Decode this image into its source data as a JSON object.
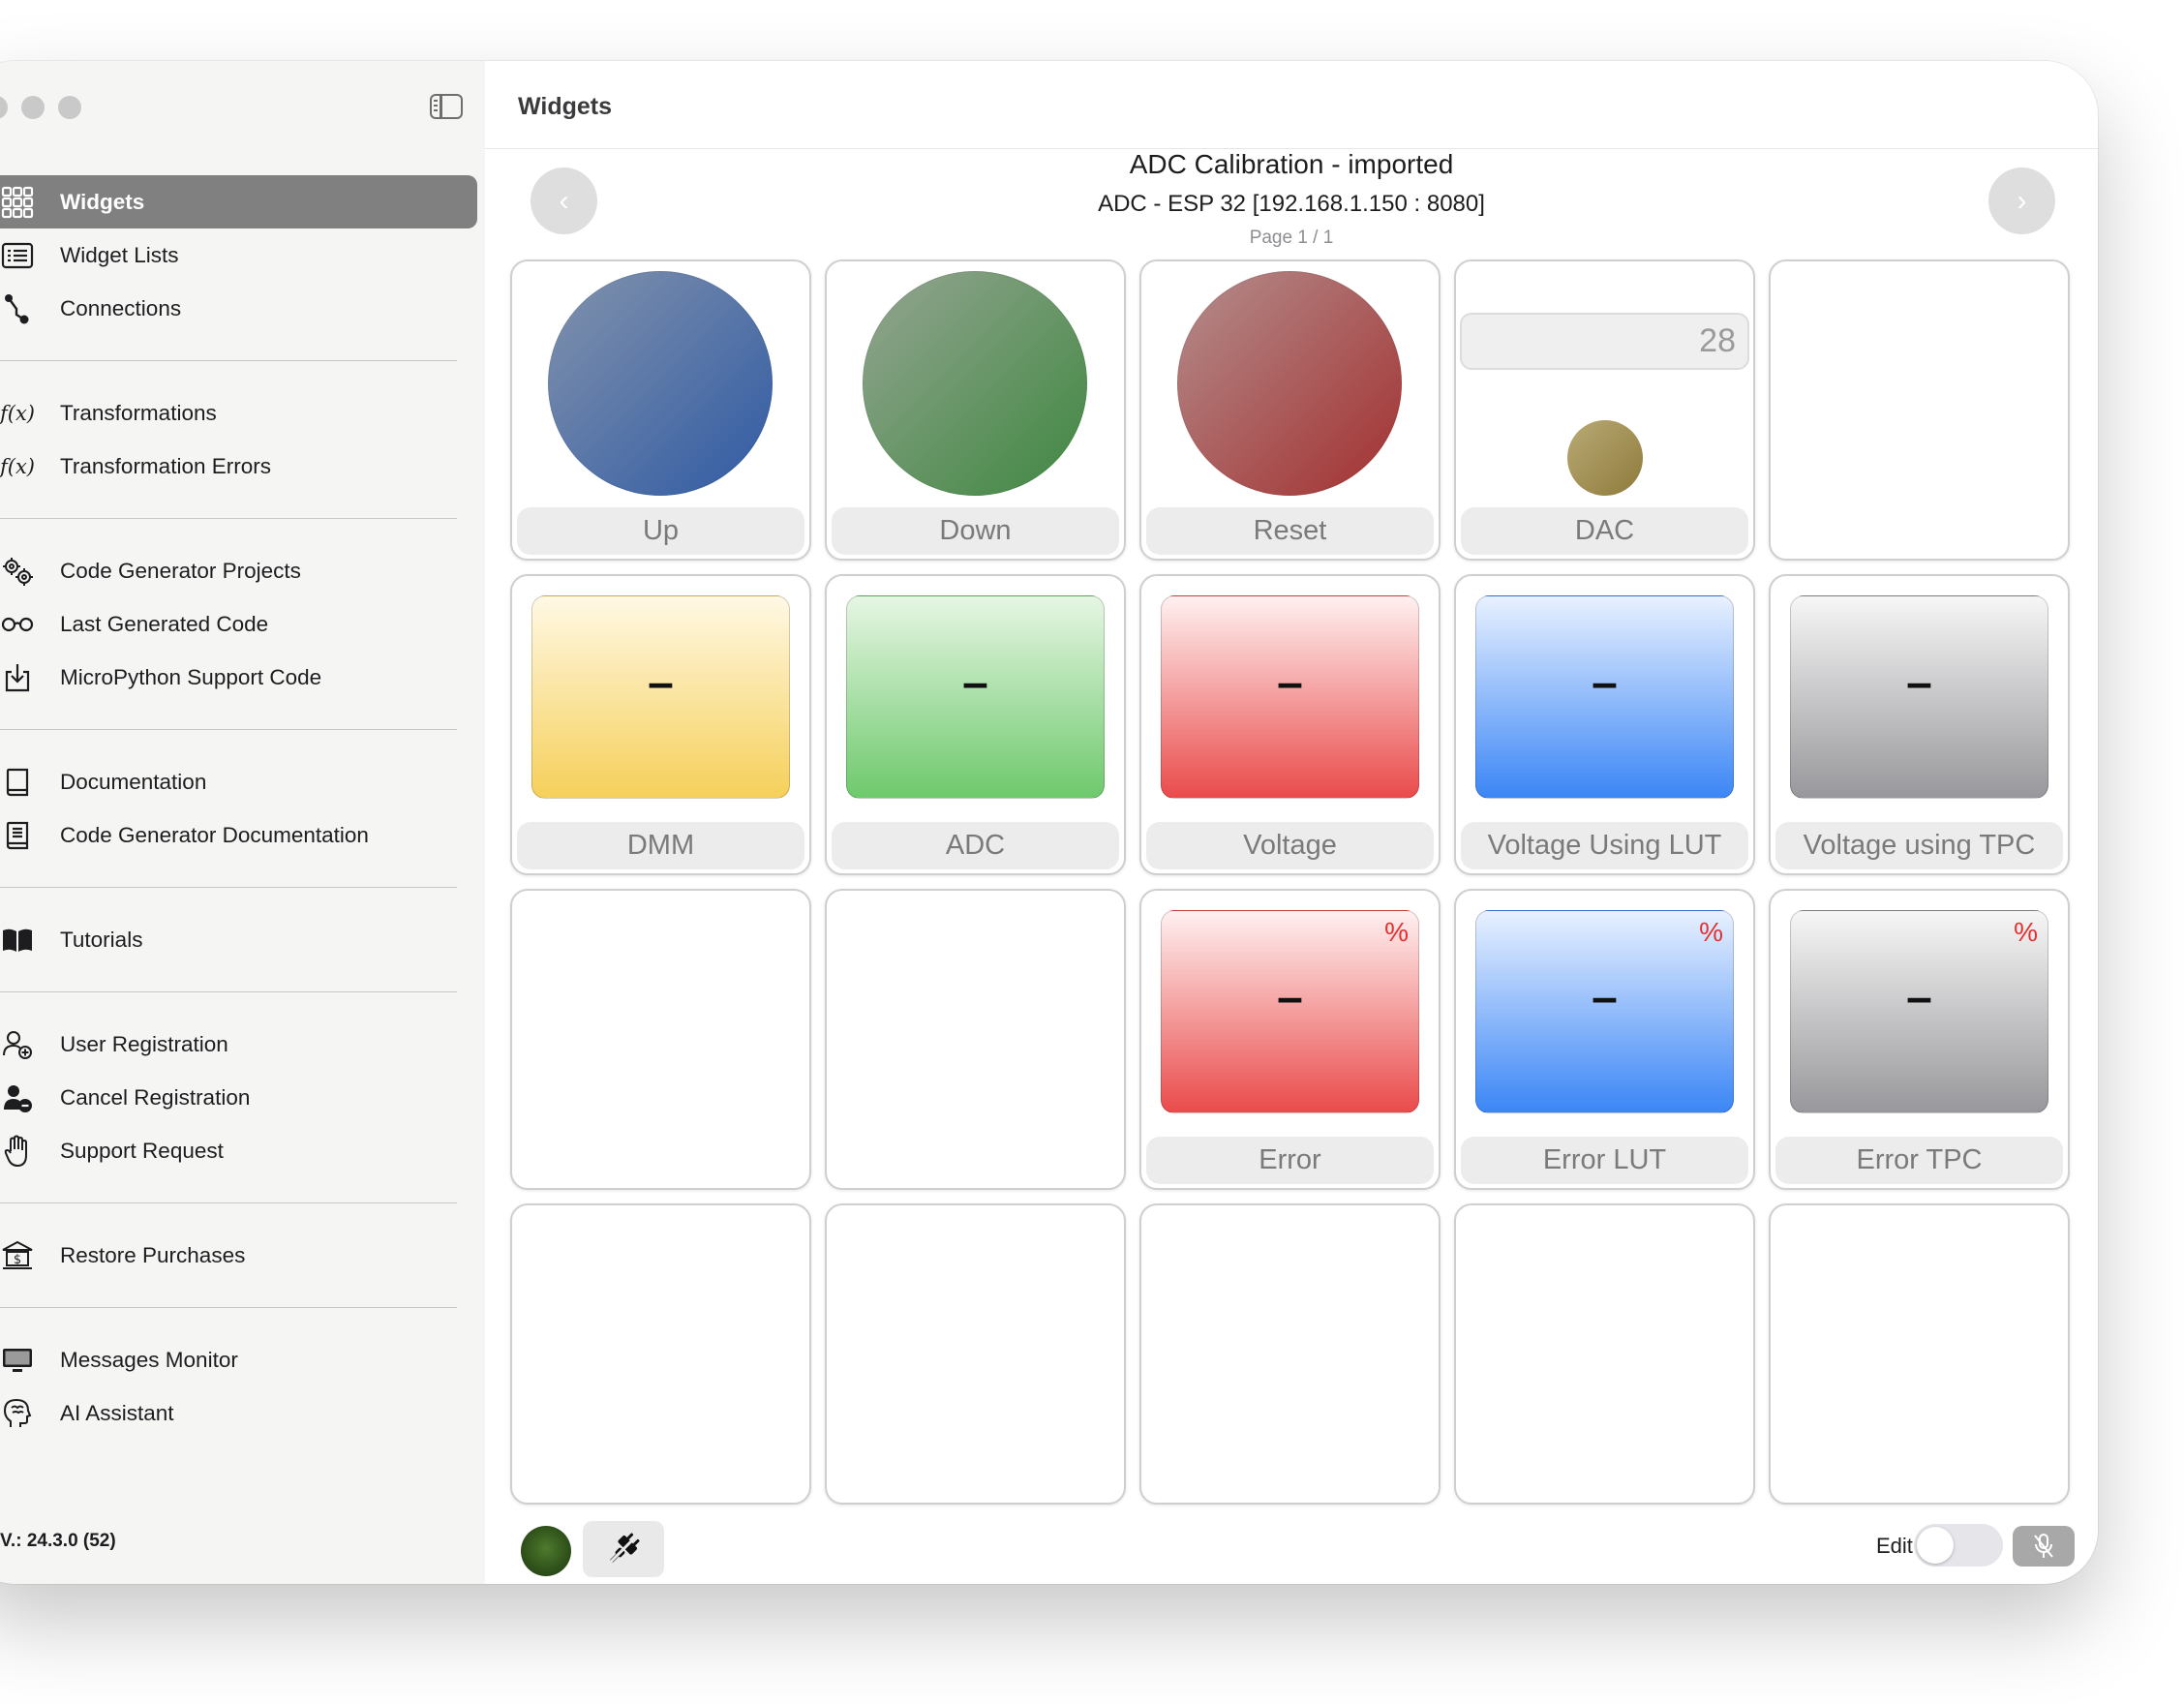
{
  "sidebar": {
    "groups": [
      {
        "items": [
          {
            "label": "Widgets",
            "icon": "grid-icon",
            "active": true
          },
          {
            "label": "Widget Lists",
            "icon": "list-icon"
          },
          {
            "label": "Connections",
            "icon": "connections-icon"
          }
        ]
      },
      {
        "items": [
          {
            "label": "Transformations",
            "icon": "function-icon"
          },
          {
            "label": "Transformation Errors",
            "icon": "function-icon"
          }
        ]
      },
      {
        "items": [
          {
            "label": "Code Generator Projects",
            "icon": "gears-icon"
          },
          {
            "label": "Last Generated Code",
            "icon": "glasses-icon"
          },
          {
            "label": "MicroPython Support Code",
            "icon": "download-icon"
          }
        ]
      },
      {
        "items": [
          {
            "label": "Documentation",
            "icon": "book-icon"
          },
          {
            "label": "Code Generator Documentation",
            "icon": "document-icon"
          }
        ]
      },
      {
        "items": [
          {
            "label": "Tutorials",
            "icon": "open-book-icon"
          }
        ]
      },
      {
        "items": [
          {
            "label": "User Registration",
            "icon": "person-add-icon"
          },
          {
            "label": "Cancel Registration",
            "icon": "person-remove-icon"
          },
          {
            "label": "Support Request",
            "icon": "hand-icon"
          }
        ]
      },
      {
        "items": [
          {
            "label": "Restore Purchases",
            "icon": "bank-icon"
          }
        ]
      },
      {
        "items": [
          {
            "label": "Messages Monitor",
            "icon": "monitor-icon"
          },
          {
            "label": "AI Assistant",
            "icon": "brain-head-icon"
          }
        ]
      }
    ],
    "version": "V.: 24.3.0 (52)"
  },
  "toolbar": {
    "title": "Widgets"
  },
  "header": {
    "title": "ADC Calibration - imported",
    "subtitle": "ADC - ESP 32 [192.168.1.150 : 8080]",
    "page": "Page 1 / 1",
    "prev_icon": "chevron-left-icon",
    "next_icon": "chevron-right-icon"
  },
  "widgets": [
    {
      "type": "button",
      "label": "Up",
      "color": "blue"
    },
    {
      "type": "button",
      "label": "Down",
      "color": "green"
    },
    {
      "type": "button",
      "label": "Reset",
      "color": "red"
    },
    {
      "type": "slider",
      "label": "DAC",
      "value": "28"
    },
    {
      "type": "empty"
    },
    {
      "type": "display",
      "label": "DMM",
      "value": "–",
      "color": "yellow"
    },
    {
      "type": "display",
      "label": "ADC",
      "value": "–",
      "color": "green"
    },
    {
      "type": "display",
      "label": "Voltage",
      "value": "–",
      "color": "red"
    },
    {
      "type": "display",
      "label": "Voltage Using LUT",
      "value": "–",
      "color": "blue"
    },
    {
      "type": "display",
      "label": "Voltage using TPC",
      "value": "–",
      "color": "gray"
    },
    {
      "type": "empty"
    },
    {
      "type": "empty"
    },
    {
      "type": "display",
      "label": "Error",
      "value": "–",
      "unit": "%",
      "color": "red"
    },
    {
      "type": "display",
      "label": "Error LUT",
      "value": "–",
      "unit": "%",
      "color": "blue"
    },
    {
      "type": "display",
      "label": "Error TPC",
      "value": "–",
      "unit": "%",
      "color": "gray"
    },
    {
      "type": "empty"
    },
    {
      "type": "empty"
    },
    {
      "type": "empty"
    },
    {
      "type": "empty"
    },
    {
      "type": "empty"
    }
  ],
  "footer": {
    "status_icon": "connection-status-icon",
    "plug_icon": "plug-icon",
    "edit_label": "Edit",
    "edit_enabled": false,
    "mic_icon": "mic-off-icon"
  }
}
